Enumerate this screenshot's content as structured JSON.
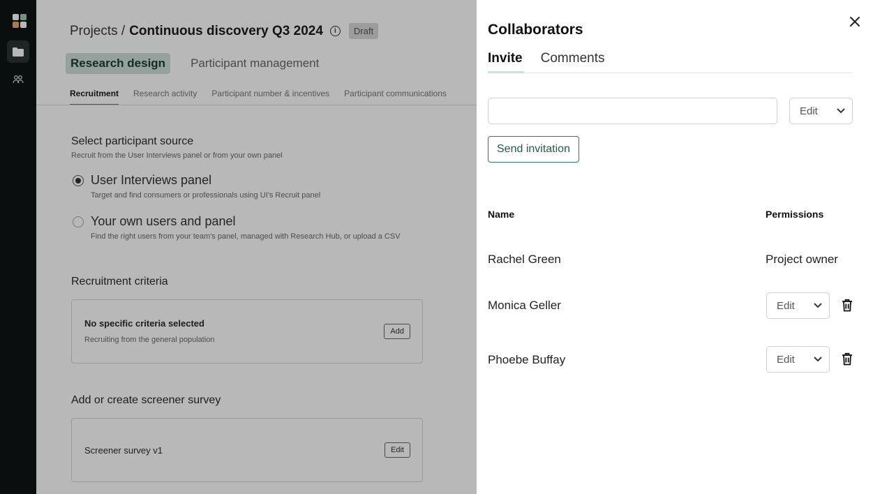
{
  "colors": {
    "accent_green": "#2f7a5c",
    "tab_highlight": "#cfe0d8",
    "rail_bg": "#0f1414"
  },
  "rail": {
    "icons": [
      "app-logo-icon",
      "folder-icon",
      "people-icon"
    ]
  },
  "main": {
    "breadcrumb": {
      "root": "Projects /",
      "project": "Continuous discovery Q3 2024",
      "badge": "Draft"
    },
    "top_tabs": [
      "Research design",
      "Participant management"
    ],
    "sub_tabs": [
      "Recruitment",
      "Research activity",
      "Participant number & incentives",
      "Participant communications"
    ],
    "participant_source": {
      "title": "Select participant source",
      "subtitle": "Recruit from the User Interviews panel or from your own panel",
      "options": [
        {
          "label": "User Interviews panel",
          "desc": "Target and find consumers or professionals using UI's Recruit panel"
        },
        {
          "label": "Your own users and panel",
          "desc": "Find the right users from your team's panel, managed with Research Hub, or upload a CSV"
        }
      ]
    },
    "criteria": {
      "title": "Recruitment criteria",
      "card_title": "No specific criteria selected",
      "card_sub": "Recruiting from the general population",
      "button": "Add"
    },
    "screener": {
      "title": "Add or create screener survey",
      "card_text": "Screener survey v1",
      "button": "Edit"
    }
  },
  "drawer": {
    "title": "Collaborators",
    "tabs": [
      "Invite",
      "Comments"
    ],
    "invite": {
      "input_value": "",
      "input_placeholder": "",
      "permission": "Edit",
      "send_label": "Send invitation"
    },
    "table": {
      "headers": {
        "name": "Name",
        "permissions": "Permissions"
      },
      "rows": [
        {
          "name": "Rachel Green",
          "permission": "Project owner"
        },
        {
          "name": "Monica Geller",
          "permission": "Edit"
        },
        {
          "name": "Phoebe Buffay",
          "permission": "Edit"
        }
      ]
    }
  }
}
